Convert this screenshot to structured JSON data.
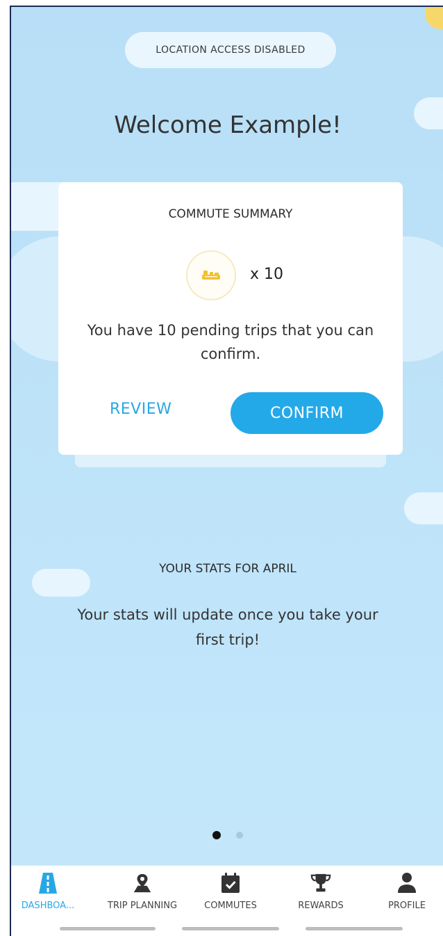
{
  "banner": {
    "text": "LOCATION ACCESS DISABLED"
  },
  "welcome": {
    "title": "Welcome Example!"
  },
  "commute_card": {
    "title": "COMMUTE SUMMARY",
    "trip_icon": "car-seat-icon",
    "trip_count": "x 10",
    "message": "You have 10 pending trips that you can confirm.",
    "review_label": "REVIEW",
    "confirm_label": "CONFIRM"
  },
  "stats": {
    "title": "YOUR STATS FOR APRIL",
    "message": "Your stats will update once you take your first trip!"
  },
  "pager": {
    "total": 2,
    "active": 1
  },
  "tabs": [
    {
      "label": "DASHBOA...",
      "icon": "road-icon",
      "active": true
    },
    {
      "label": "TRIP PLANNING",
      "icon": "map-pin-icon",
      "active": false
    },
    {
      "label": "COMMUTES",
      "icon": "calendar-check-icon",
      "active": false
    },
    {
      "label": "REWARDS",
      "icon": "trophy-icon",
      "active": false
    },
    {
      "label": "PROFILE",
      "icon": "person-icon",
      "active": false
    }
  ],
  "colors": {
    "accent": "#27a8e4",
    "confirm_button": "#24a9e8",
    "sky": "#bfe4f9",
    "trip_icon": "#f2c12e"
  }
}
